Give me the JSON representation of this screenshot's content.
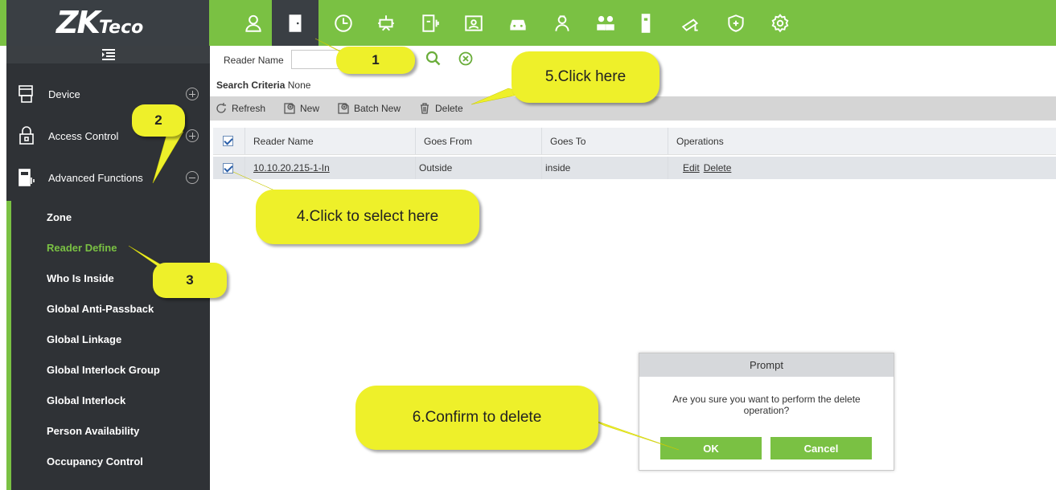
{
  "brand": {
    "logo_main": "ZK",
    "logo_sub": "Teco",
    "accent_color": "#7ac143",
    "dark_color": "#3a3f44"
  },
  "top_nav": {
    "icons": [
      {
        "name": "personnel-icon"
      },
      {
        "name": "access-door-icon",
        "active": true
      },
      {
        "name": "attendance-clock-icon"
      },
      {
        "name": "elevator-icon"
      },
      {
        "name": "time-attendance-icon"
      },
      {
        "name": "visitor-icon"
      },
      {
        "name": "parking-car-icon"
      },
      {
        "name": "patrol-guard-icon"
      },
      {
        "name": "meeting-people-icon"
      },
      {
        "name": "locker-icon"
      },
      {
        "name": "video-camera-icon"
      },
      {
        "name": "security-shield-icon"
      },
      {
        "name": "settings-gear-icon"
      }
    ]
  },
  "sidebar": {
    "groups": [
      {
        "label": "Device",
        "toggle": "plus"
      },
      {
        "label": "Access Control",
        "toggle": "plus"
      },
      {
        "label": "Advanced Functions",
        "toggle": "minus"
      }
    ],
    "items": [
      {
        "label": "Zone"
      },
      {
        "label": "Reader Define",
        "active": true
      },
      {
        "label": "Who Is Inside"
      },
      {
        "label": "Global Anti-Passback"
      },
      {
        "label": "Global Linkage"
      },
      {
        "label": "Global Interlock Group"
      },
      {
        "label": "Global Interlock"
      },
      {
        "label": "Person Availability"
      },
      {
        "label": "Occupancy Control"
      }
    ]
  },
  "search": {
    "label": "Reader Name",
    "value": ""
  },
  "criteria": {
    "label": "Search Criteria",
    "value": "None"
  },
  "toolbar": {
    "refresh": "Refresh",
    "new": "New",
    "batch_new": "Batch New",
    "delete": "Delete"
  },
  "table": {
    "columns": [
      "Reader Name",
      "Goes From",
      "Goes To",
      "Operations"
    ],
    "rows": [
      {
        "reader_name": "10.10.20.215-1-In",
        "goes_from": "Outside",
        "goes_to": "inside",
        "op_edit": "Edit",
        "op_delete": "Delete"
      }
    ]
  },
  "dialog": {
    "title": "Prompt",
    "message": "Are you sure you want to perform the delete operation?",
    "ok": "OK",
    "cancel": "Cancel"
  },
  "callouts": {
    "c1": "1",
    "c2": "2",
    "c3": "3",
    "c4": "4.Click to select here",
    "c5": "5.Click here",
    "c6": "6.Confirm to delete"
  }
}
